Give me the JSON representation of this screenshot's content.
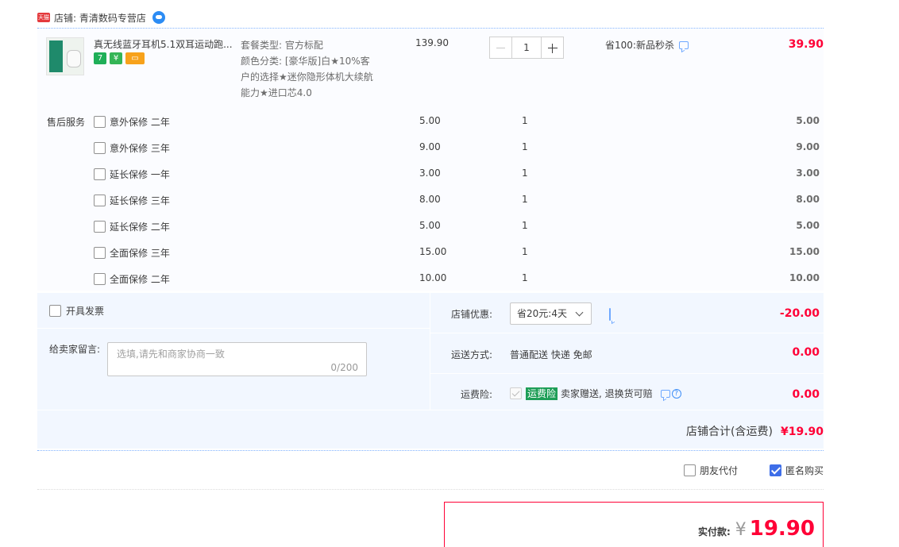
{
  "shop": {
    "badge_text": "天猫",
    "label": "店铺: 青清数码专营店"
  },
  "item": {
    "title": "真无线蓝牙耳机5.1双耳运动跑...",
    "sku": [
      "套餐类型: 官方标配",
      "颜色分类: [豪华版]白★10%客",
      "户的选择★迷你隐形体机大续航",
      "能力★进口芯4.0"
    ],
    "unit_price": "139.90",
    "quantity": "1",
    "promo": "省100:新品秒杀",
    "subtotal": "39.90",
    "badges": [
      "7",
      "¥",
      "▭"
    ]
  },
  "after_sales": {
    "label": "售后服务",
    "services": [
      {
        "name": "意外保修 二年",
        "price": "5.00",
        "count": "1",
        "total": "5.00"
      },
      {
        "name": "意外保修 三年",
        "price": "9.00",
        "count": "1",
        "total": "9.00"
      },
      {
        "name": "延长保修 一年",
        "price": "3.00",
        "count": "1",
        "total": "3.00"
      },
      {
        "name": "延长保修 三年",
        "price": "8.00",
        "count": "1",
        "total": "8.00"
      },
      {
        "name": "延长保修 二年",
        "price": "5.00",
        "count": "1",
        "total": "5.00"
      },
      {
        "name": "全面保修 三年",
        "price": "15.00",
        "count": "1",
        "total": "15.00"
      },
      {
        "name": "全面保修 二年",
        "price": "10.00",
        "count": "1",
        "total": "10.00"
      }
    ]
  },
  "order": {
    "invoice_label": "开具发票",
    "message_label": "给卖家留言:",
    "message_placeholder": "选填,请先和商家协商一致",
    "message_count": "0/200",
    "coupon_label": "店铺优惠:",
    "coupon_value": "省20元:4天",
    "coupon_amount": "-20.00",
    "shipping_label": "运送方式:",
    "shipping_value": "普通配送 快递 免邮",
    "shipping_amount": "0.00",
    "insurance_label": "运费险:",
    "insurance_tag": "运费险",
    "insurance_text": "卖家赠送, 退换货可赔",
    "insurance_amount": "0.00",
    "shop_total_label": "店铺合计(含运费)",
    "shop_total_value": "¥19.90"
  },
  "footer": {
    "friend_pay_label": "朋友代付",
    "anonymous_label": "匿名购买",
    "anonymous_checked": true,
    "pay_label": "实付款:",
    "pay_currency": "¥",
    "pay_amount": "19.90"
  },
  "colors": {
    "accent_red": "#ff0036",
    "panel_blue": "#f2f7ff",
    "check_blue": "#3e6ee8"
  }
}
